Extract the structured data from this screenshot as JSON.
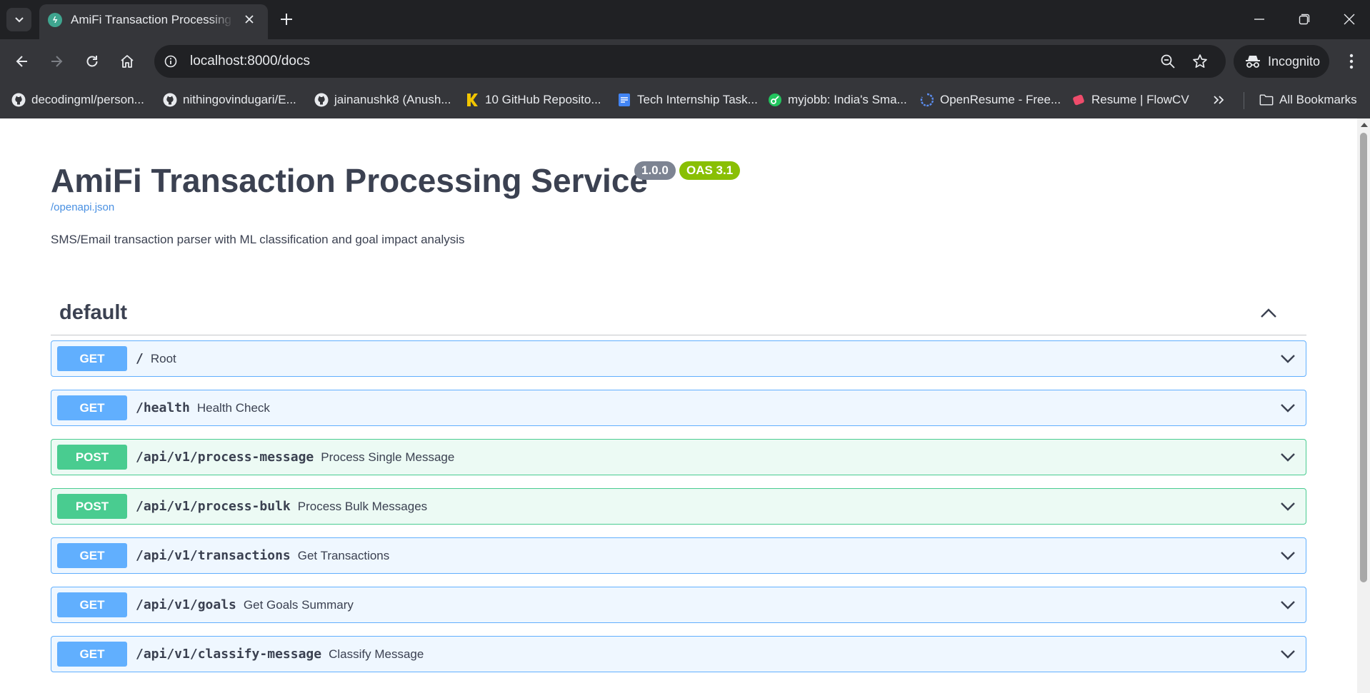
{
  "browser": {
    "tab_title": "AmiFi Transaction Processing Service - Swagger UI",
    "url": "localhost:8000/docs",
    "profile_label": "Incognito",
    "bookmarks": [
      {
        "label": "decodingml/person...",
        "icon": "github-icon"
      },
      {
        "label": "nithingovindugari/E...",
        "icon": "github-icon"
      },
      {
        "label": "jainanushk8 (Anush...",
        "icon": "github-icon"
      },
      {
        "label": "10 GitHub Reposito...",
        "icon": "k-logo-icon"
      },
      {
        "label": "Tech Internship Task...",
        "icon": "google-docs-icon"
      },
      {
        "label": "myjobb: India's Sma...",
        "icon": "myjobb-icon"
      },
      {
        "label": "OpenResume - Free...",
        "icon": "openresume-icon"
      },
      {
        "label": "Resume | FlowCV",
        "icon": "flowcv-icon"
      }
    ],
    "all_bookmarks_label": "All Bookmarks"
  },
  "info": {
    "title": "AmiFi Transaction Processing Service",
    "version": "1.0.0",
    "oas": "OAS 3.1",
    "spec_link": "/openapi.json",
    "description": "SMS/Email transaction parser with ML classification and goal impact analysis"
  },
  "tag": {
    "name": "default"
  },
  "operations": [
    {
      "method": "GET",
      "path": "/",
      "summary": "Root"
    },
    {
      "method": "GET",
      "path": "/health",
      "summary": "Health Check"
    },
    {
      "method": "POST",
      "path": "/api/v1/process-message",
      "summary": "Process Single Message"
    },
    {
      "method": "POST",
      "path": "/api/v1/process-bulk",
      "summary": "Process Bulk Messages"
    },
    {
      "method": "GET",
      "path": "/api/v1/transactions",
      "summary": "Get Transactions"
    },
    {
      "method": "GET",
      "path": "/api/v1/goals",
      "summary": "Get Goals Summary"
    },
    {
      "method": "GET",
      "path": "/api/v1/classify-message",
      "summary": "Classify Message"
    }
  ],
  "colors": {
    "get": "#61affe",
    "post": "#49cc90",
    "version_badge": "#7d8492",
    "oas_badge": "#89bf04",
    "link": "#4990e2",
    "text": "#3b4151"
  }
}
